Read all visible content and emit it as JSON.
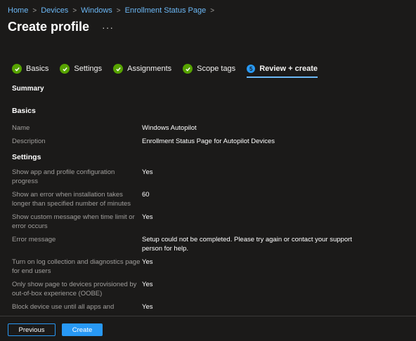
{
  "breadcrumb": [
    "Home",
    "Devices",
    "Windows",
    "Enrollment Status Page"
  ],
  "page_title": "Create profile",
  "more_label": "···",
  "tabs": [
    {
      "label": "Basics",
      "state": "complete"
    },
    {
      "label": "Settings",
      "state": "complete"
    },
    {
      "label": "Assignments",
      "state": "complete"
    },
    {
      "label": "Scope tags",
      "state": "complete"
    },
    {
      "label": "Review + create",
      "state": "active",
      "number": "5"
    }
  ],
  "summary_label": "Summary",
  "basics": {
    "heading": "Basics",
    "rows": [
      {
        "label": "Name",
        "value": "Windows Autopilot"
      },
      {
        "label": "Description",
        "value": "Enrollment  Status Page for Autopilot Devices"
      }
    ]
  },
  "settings": {
    "heading": "Settings",
    "rows": [
      {
        "label": "Show app and profile configuration progress",
        "value": "Yes"
      },
      {
        "label": "Show an error when installation takes longer than specified number of minutes",
        "value": "60"
      },
      {
        "label": "Show custom message when time limit or error occurs",
        "value": "Yes"
      },
      {
        "label": "Error message",
        "value": "Setup could not be completed. Please try again or contact your support person for help."
      },
      {
        "label": "Turn on log collection and diagnostics page for end users",
        "value": "Yes"
      },
      {
        "label": "Only show page to devices provisioned by out-of-box experience (OOBE)",
        "value": "Yes"
      },
      {
        "label": "Block device use until all apps and",
        "value": "Yes"
      }
    ]
  },
  "footer": {
    "previous_label": "Previous",
    "create_label": "Create"
  },
  "colors": {
    "background": "#1b1a19",
    "accent": "#2899f5",
    "link": "#6cb8f6",
    "success": "#57a300"
  }
}
